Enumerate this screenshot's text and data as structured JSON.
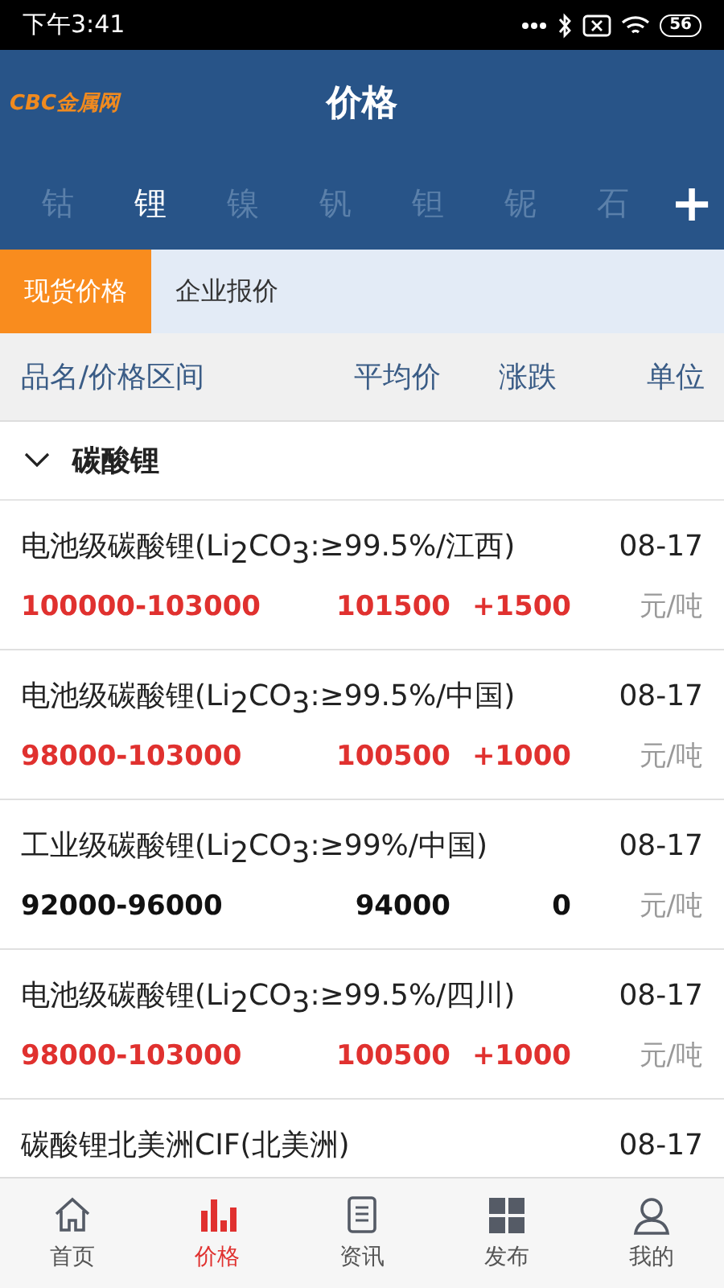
{
  "status_bar": {
    "time": "下午3:41",
    "battery": "56"
  },
  "header": {
    "logo": "CBC金属网",
    "title": "价格"
  },
  "metal_tabs": [
    {
      "label": "钴",
      "selected": false
    },
    {
      "label": "锂",
      "selected": true
    },
    {
      "label": "镍",
      "selected": false
    },
    {
      "label": "钒",
      "selected": false
    },
    {
      "label": "钽",
      "selected": false
    },
    {
      "label": "铌",
      "selected": false
    },
    {
      "label": "石",
      "selected": false
    }
  ],
  "add_button": "+",
  "sub_tabs": [
    {
      "label": "现货价格",
      "selected": true
    },
    {
      "label": "企业报价",
      "selected": false
    }
  ],
  "columns": [
    "品名/价格区间",
    "平均价",
    "涨跌",
    "单位"
  ],
  "section": {
    "title": "碳酸锂",
    "expanded": true
  },
  "rows": [
    {
      "name": "电池级碳酸锂(Li$_{2}$CO$_{3}$:≥99.5%/江西)",
      "date": "08-17",
      "range": "100000-103000",
      "average": "101500",
      "change": "+1500",
      "kind": "rise",
      "unit": "元/吨"
    },
    {
      "name": "电池级碳酸锂(Li$_{2}$CO$_{3}$:≥99.5%/中国)",
      "date": "08-17",
      "range": "98000-103000",
      "average": "100500",
      "change": "+1000",
      "kind": "rise",
      "unit": "元/吨"
    },
    {
      "name": "工业级碳酸锂(Li$_{2}$CO$_{3}$:≥99%/中国)",
      "date": "08-17",
      "range": "92000-96000",
      "average": "94000",
      "change": "0",
      "kind": "flat",
      "unit": "元/吨"
    },
    {
      "name": "电池级碳酸锂(Li$_{2}$CO$_{3}$:≥99.5%/四川)",
      "date": "08-17",
      "range": "98000-103000",
      "average": "100500",
      "change": "+1000",
      "kind": "rise",
      "unit": "元/吨"
    },
    {
      "name": "碳酸锂北美洲CIF(北美洲)",
      "date": "08-17"
    }
  ],
  "nav": [
    {
      "label": "首页",
      "selected": false
    },
    {
      "label": "价格",
      "selected": true
    },
    {
      "label": "资讯",
      "selected": false
    },
    {
      "label": "发布",
      "selected": false
    },
    {
      "label": "我的",
      "selected": false
    }
  ]
}
